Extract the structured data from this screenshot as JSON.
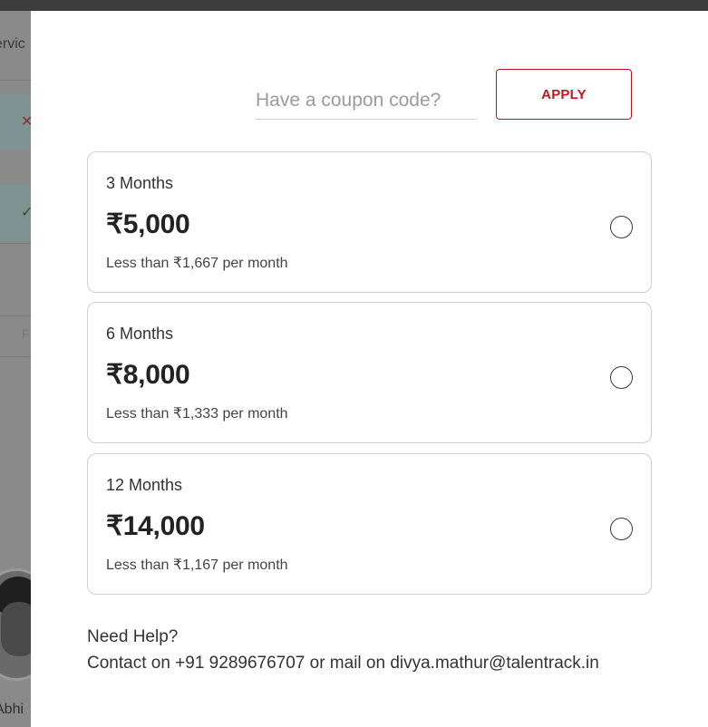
{
  "background_page": {
    "nav_text": "ervic",
    "row_cross_symbol": "✕",
    "row_check_symbol": "✓",
    "faint_text": "F",
    "person_name": "Abhi"
  },
  "coupon": {
    "placeholder": "Have a coupon code?",
    "value": "",
    "apply_label": "APPLY"
  },
  "plans": [
    {
      "duration": "3 Months",
      "price": "₹5,000",
      "note": "Less than ₹1,667 per month",
      "selected": false
    },
    {
      "duration": "6 Months",
      "price": "₹8,000",
      "note": "Less than ₹1,333 per month",
      "selected": false
    },
    {
      "duration": "12 Months",
      "price": "₹14,000",
      "note": "Less than ₹1,167 per month",
      "selected": false
    }
  ],
  "help": {
    "title": "Need Help?",
    "contact": "Contact on +91 9289676707 or mail on divya.mathur@talentrack.in"
  },
  "colors": {
    "accent": "#c4161c",
    "overlay": "#6e6e6e",
    "card_border": "#cfcfcf"
  }
}
